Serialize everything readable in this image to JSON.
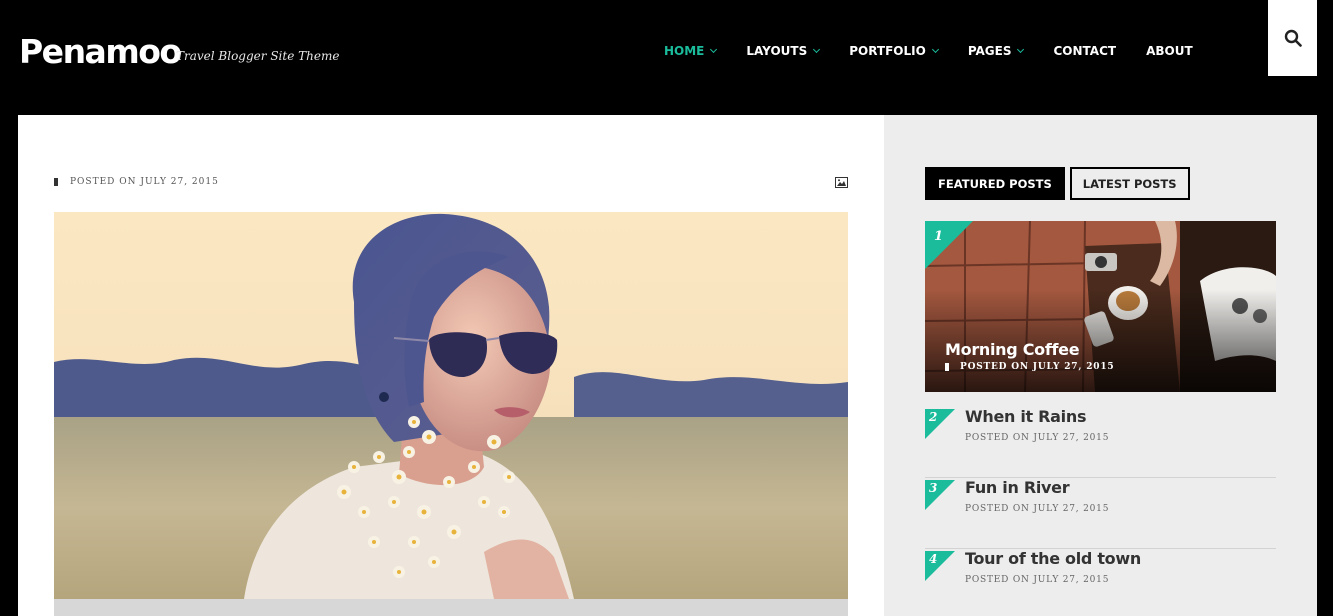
{
  "site": {
    "logo": "Penamoo",
    "tagline": "Travel Blogger Site Theme"
  },
  "nav": {
    "items": [
      {
        "label": "HOME",
        "has_dropdown": true,
        "active": true
      },
      {
        "label": "LAYOUTS",
        "has_dropdown": true,
        "active": false
      },
      {
        "label": "PORTFOLIO",
        "has_dropdown": true,
        "active": false
      },
      {
        "label": "PAGES",
        "has_dropdown": true,
        "active": false
      },
      {
        "label": "CONTACT",
        "has_dropdown": false,
        "active": false
      },
      {
        "label": "ABOUT",
        "has_dropdown": false,
        "active": false
      }
    ],
    "search_icon": "search-icon"
  },
  "article": {
    "meta": "POSTED ON JULY 27, 2015",
    "format_icon": "image-icon",
    "hero_image": "woman-with-sunglasses-holding-daisies-in-field"
  },
  "sidebar": {
    "tabs": [
      {
        "label": "FEATURED POSTS",
        "active": true
      },
      {
        "label": "LATEST POSTS",
        "active": false
      }
    ],
    "featured": {
      "number": "1",
      "title": "Morning Coffee",
      "date": "POSTED ON JULY 27, 2015",
      "image": "coffee-cup-phone-magazine-on-table"
    },
    "posts": [
      {
        "number": "2",
        "title": "When it Rains",
        "date": "POSTED ON JULY 27, 2015"
      },
      {
        "number": "3",
        "title": "Fun in River",
        "date": "POSTED ON JULY 27, 2015"
      },
      {
        "number": "4",
        "title": "Tour of the old town",
        "date": "POSTED ON JULY 27, 2015"
      }
    ]
  },
  "colors": {
    "accent": "#1abc9c",
    "header_bg": "#000000",
    "sidebar_bg": "#ededed",
    "text_dark": "#333333"
  }
}
